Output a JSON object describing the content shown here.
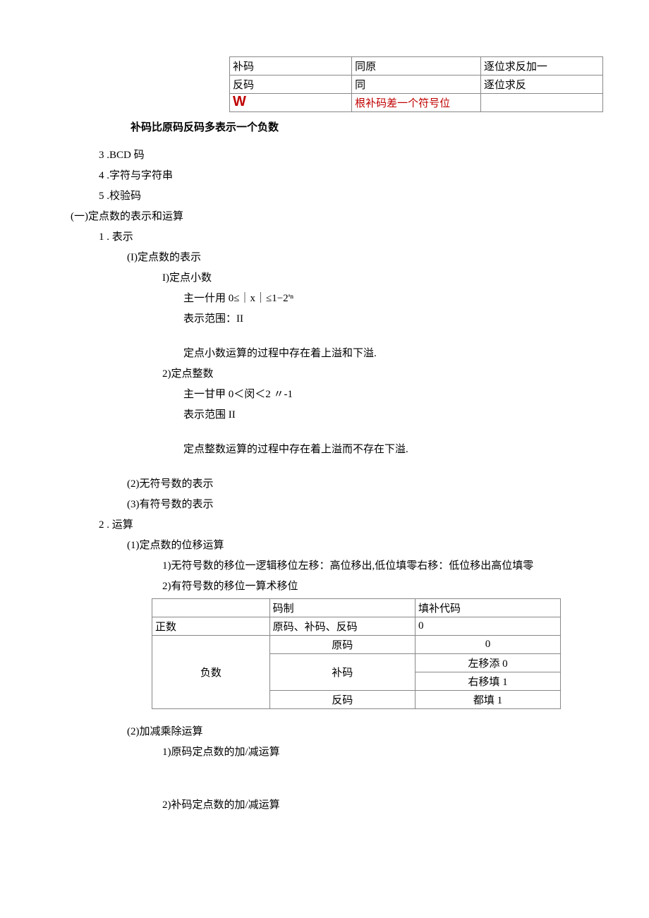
{
  "table1": {
    "rows": [
      {
        "c1": "补码",
        "c2": "同原",
        "c3": "逐位求反加一"
      },
      {
        "c1": "反码",
        "c2": "同",
        "c3": "逐位求反"
      },
      {
        "c1_icon": "W",
        "c2": "根补码差一个符号位",
        "c3": ""
      }
    ]
  },
  "bold_note": "补码比原码反码多表示一个负数",
  "list": {
    "i3": "3  .BCD 码",
    "i4": "4  .字符与字符串",
    "i5": "5  .校验码",
    "sec1": "(一)定点数的表示和运算",
    "s1": "1  . 表示",
    "s1_1": "(I)定点数的表示",
    "s1_1_1": "I)定点小数",
    "s1_1_1a": "主一什用 0≤｜x｜≤1−2'ⁿ",
    "s1_1_1b": "表示范围：II",
    "s1_1_1c": "定点小数运算的过程中存在着上溢和下溢.",
    "s1_1_2": "2)定点整数",
    "s1_1_2a": "主一甘甲 0＜闵＜2 〃-1",
    "s1_1_2b": "表示范围 II",
    "s1_1_2c": "定点整数运算的过程中存在着上溢而不存在下溢.",
    "s1_2": "(2)无符号数的表示",
    "s1_3": "(3)有符号数的表示",
    "s2": "2  . 运算",
    "s2_1": "(1)定点数的位移运算",
    "s2_1_1": "1)无符号数的移位一逻辑移位左移：高位移出,低位填零右移：低位移出高位填零",
    "s2_1_2": "2)有符号数的移位一算术移位",
    "s2_2": "(2)加减乘除运算",
    "s2_2_1": "1)原码定点数的加/减运算",
    "s2_2_2": "2)补码定点数的加/减运算"
  },
  "table2": {
    "header": {
      "c1": "",
      "c2": "码制",
      "c3": "填补代码"
    },
    "row_pos": {
      "c1": "正数",
      "c2": "原码、补码、反码",
      "c3": "0"
    },
    "neg_label": "负数",
    "neg_rows": [
      {
        "c2": "原码",
        "c3": "0"
      },
      {
        "c2": "补码",
        "c3a": "左移添 0",
        "c3b": "右移填 1"
      },
      {
        "c2": "反码",
        "c3": "都填 1"
      }
    ]
  }
}
